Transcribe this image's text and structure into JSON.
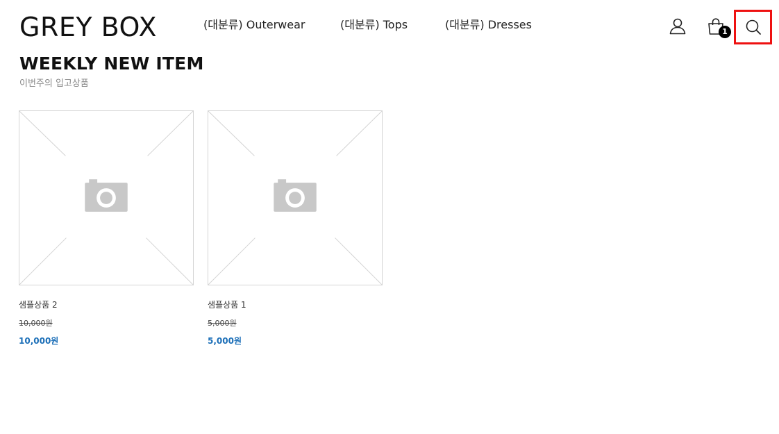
{
  "header": {
    "logo": "GREY BOX",
    "nav": [
      {
        "label": "(대분류) Outerwear"
      },
      {
        "label": "(대분류) Tops"
      },
      {
        "label": "(대분류) Dresses"
      }
    ],
    "icons": {
      "account": "user-icon",
      "cart": "shopping-bag-icon",
      "search": "search-icon"
    },
    "cart_count": "1",
    "highlight_color": "#ee1111"
  },
  "section": {
    "title": "WEEKLY NEW ITEM",
    "subtitle": "이번주의 입고상품"
  },
  "products": [
    {
      "name": "샘플상품 2",
      "original_price": "10,000원",
      "price": "10,000원",
      "image_icon": "camera-placeholder-icon"
    },
    {
      "name": "샘플상품 1",
      "original_price": "5,000원",
      "price": "5,000원",
      "image_icon": "camera-placeholder-icon"
    }
  ],
  "colors": {
    "price": "#1c6fb8",
    "placeholder": "#c8c8c8"
  }
}
